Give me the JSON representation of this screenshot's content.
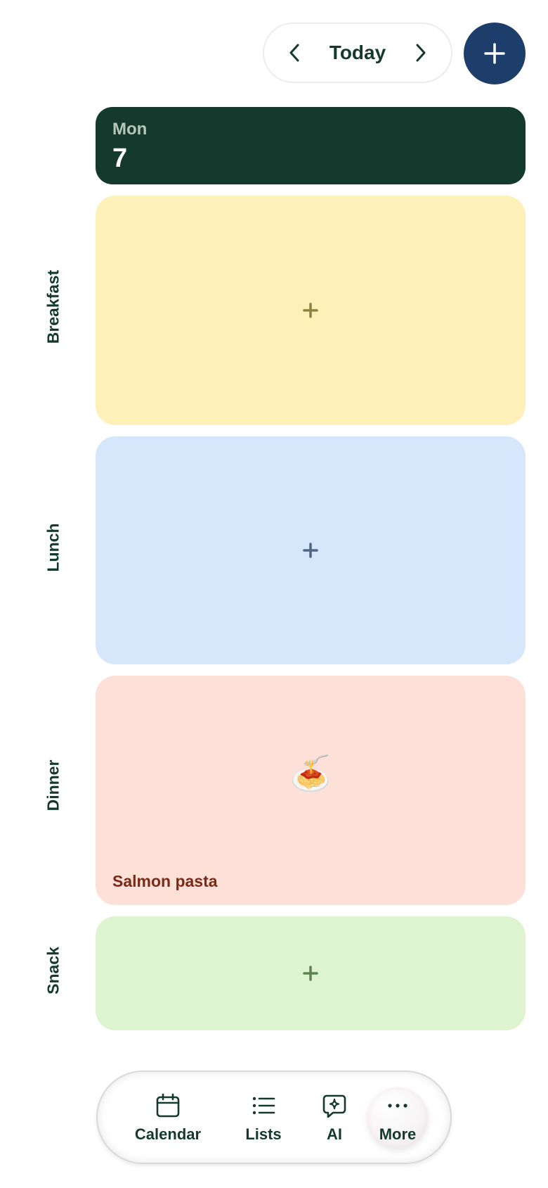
{
  "date_nav": {
    "label": "Today",
    "prev_icon": "chevron-left-icon",
    "next_icon": "chevron-right-icon"
  },
  "add_button": {
    "icon": "plus-icon",
    "color": "#1d3d6b"
  },
  "day": {
    "weekday": "Mon",
    "number": "7",
    "color": "#143a2d"
  },
  "meals": [
    {
      "label": "Breakfast",
      "color": "#fdf0b8",
      "plus_color": "#8b8544",
      "empty": true
    },
    {
      "label": "Lunch",
      "color": "#d6e7fb",
      "plus_color": "#4f6684",
      "empty": true
    },
    {
      "label": "Dinner",
      "color": "#fde0d8",
      "empty": false,
      "emoji": "🍝",
      "title": "Salmon pasta"
    },
    {
      "label": "Snack",
      "color": "#def4d0",
      "plus_color": "#5c8352",
      "empty": true
    }
  ],
  "bottom_nav": {
    "items": [
      {
        "label": "Calendar",
        "icon": "calendar-icon"
      },
      {
        "label": "Lists",
        "icon": "list-icon"
      },
      {
        "label": "AI",
        "icon": "ai-chat-icon"
      },
      {
        "label": "More",
        "icon": "more-icon"
      }
    ]
  }
}
